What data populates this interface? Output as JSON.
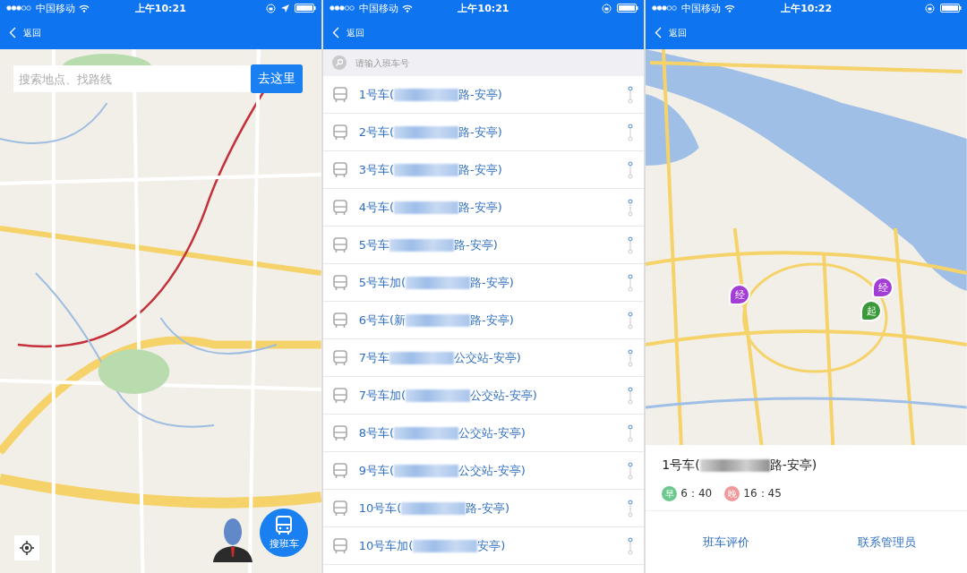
{
  "screens": [
    {
      "kind": "map_search",
      "status_bar": {
        "carrier": "中国移动",
        "time": "上午10:21",
        "location_on": true
      },
      "nav": {
        "back": "返回"
      },
      "search": {
        "placeholder": "搜索地点、找路线",
        "button": "去这里"
      },
      "bus_button": "搜班车"
    },
    {
      "kind": "route_list",
      "status_bar": {
        "carrier": "中国移动",
        "time": "上午10:21",
        "location_on": false
      },
      "nav": {
        "back": "返回"
      },
      "search": {
        "placeholder": "请输入班车号"
      },
      "routes": [
        {
          "start": "1号车(",
          "end": "路-安亭)"
        },
        {
          "start": "2号车(",
          "end": "路-安亭)"
        },
        {
          "start": "3号车(",
          "end": "路-安亭)"
        },
        {
          "start": "4号车(",
          "end": "路-安亭)"
        },
        {
          "start": "5号车",
          "end": "路-安亭)"
        },
        {
          "start": "5号车加(",
          "end": "路-安亭)"
        },
        {
          "start": "6号车(新",
          "end": "路-安亭)"
        },
        {
          "start": "7号车",
          "end": "公交站-安亭)"
        },
        {
          "start": "7号车加(",
          "end": "公交站-安亭)"
        },
        {
          "start": "8号车(",
          "end": "公交站-安亭)"
        },
        {
          "start": "9号车(",
          "end": "公交站-安亭)"
        },
        {
          "start": "10号车(",
          "end": "路-安亭)"
        },
        {
          "start": "10号车加(",
          "end": "安亭)"
        }
      ]
    },
    {
      "kind": "route_detail",
      "status_bar": {
        "carrier": "中国移动",
        "time": "上午10:22",
        "location_on": false
      },
      "nav": {
        "back": "返回"
      },
      "markers": [
        {
          "label": "经",
          "color": "#a23dd6"
        },
        {
          "label": "经",
          "color": "#a23dd6"
        },
        {
          "label": "起",
          "color": "#3a9a3a"
        }
      ],
      "route": {
        "start": "1号车(",
        "end": "路-安亭)"
      },
      "times": [
        {
          "badge": "早",
          "time": "6：40",
          "color": "#6cc98e"
        },
        {
          "badge": "晚",
          "time": "16：45",
          "color": "#f0989a"
        }
      ],
      "actions": [
        "班车评价",
        "联系管理员"
      ]
    }
  ]
}
